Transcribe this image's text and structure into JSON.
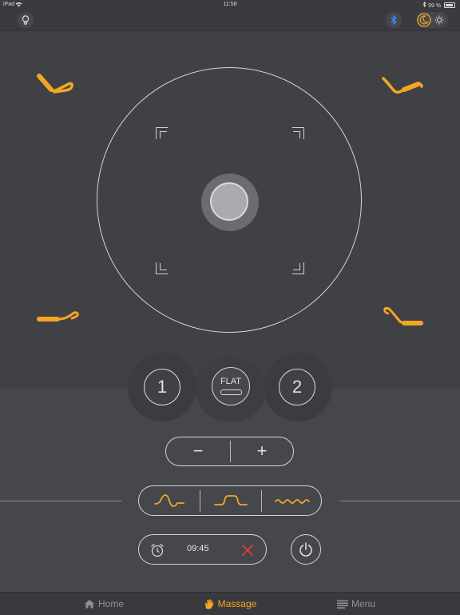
{
  "status_bar": {
    "device": "iPad",
    "time": "11:58",
    "battery": "99 %"
  },
  "flat_button": {
    "label": "FLAT"
  },
  "memory_buttons": [
    {
      "label": "1"
    },
    {
      "label": "2"
    }
  ],
  "stepper": {
    "minus": "−",
    "plus": "+"
  },
  "timer": {
    "value": "09:45"
  },
  "tabs": [
    {
      "label": "Home",
      "icon": "home-icon",
      "active": false
    },
    {
      "label": "Massage",
      "icon": "hand-icon",
      "active": true
    },
    {
      "label": "Menu",
      "icon": "menu-icon",
      "active": false
    }
  ],
  "colors": {
    "accent": "#f5a623",
    "background": "#3f4145",
    "danger": "#e03c3c",
    "bluetooth": "#3d8bff"
  }
}
